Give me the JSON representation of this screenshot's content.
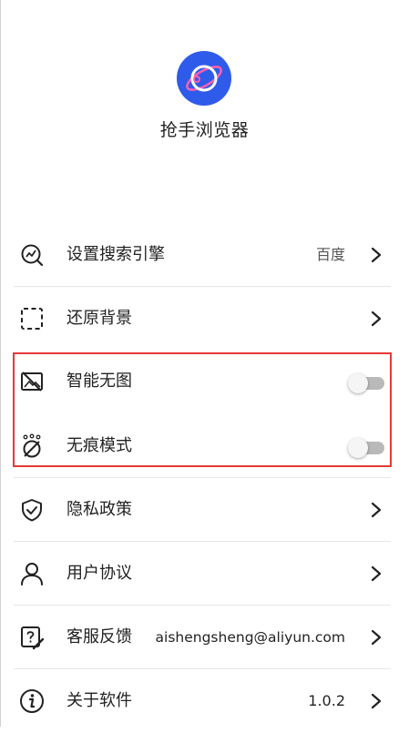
{
  "app": {
    "name": "抢手浏览器",
    "brand_color": "#2f5bea"
  },
  "settings": [
    {
      "label": "设置搜索引擎",
      "value": "百度",
      "icon": "search-engine-icon"
    },
    {
      "label": "还原背景",
      "icon": "dashed-square-icon"
    },
    {
      "label": "智能无图",
      "icon": "no-image-icon",
      "toggle": false
    },
    {
      "label": "无痕模式",
      "icon": "incognito-icon",
      "toggle": false
    },
    {
      "label": "隐私政策",
      "icon": "shield-check-icon"
    },
    {
      "label": "用户协议",
      "icon": "user-icon"
    },
    {
      "label": "客服反馈",
      "value": "aishengsheng@aliyun.com",
      "icon": "help-edit-icon"
    },
    {
      "label": "关于软件",
      "value": "1.0.2",
      "icon": "info-icon"
    }
  ],
  "highlight_color": "#e53935"
}
